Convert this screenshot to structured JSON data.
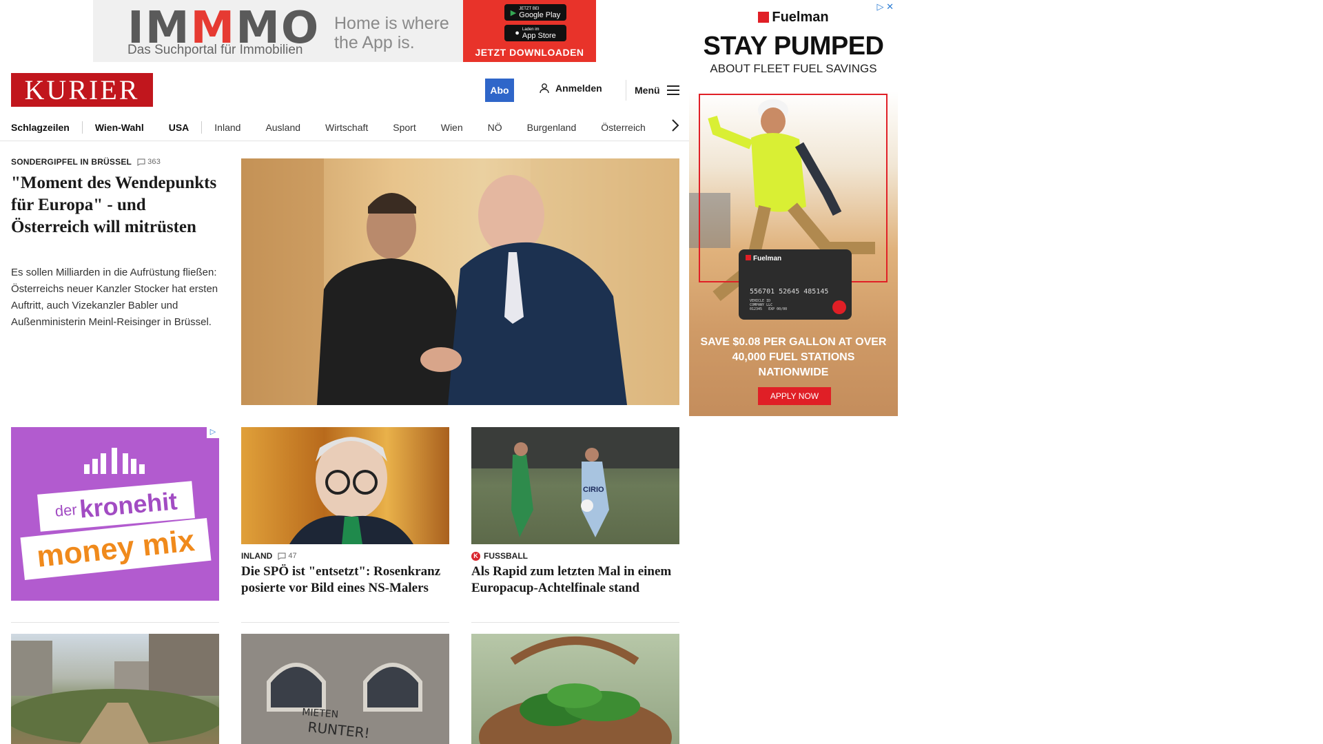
{
  "top_ad": {
    "logo_gray_1": "IM",
    "logo_red": "M",
    "logo_gray_2": "MO",
    "subline": "Das Suchportal für Immobilien",
    "tagline": "Home is where the App is.",
    "google_play_small": "JETZT BEI",
    "google_play": "Google Play",
    "app_store_small": "Laden im",
    "app_store": "App Store",
    "cta": "JETZT DOWNLOADEN"
  },
  "header": {
    "logo": "KURIER",
    "abo": "Abo",
    "login": "Anmelden",
    "menu": "Menü"
  },
  "nav": {
    "items": [
      "Schlagzeilen",
      "Wien-Wahl",
      "USA",
      "Inland",
      "Ausland",
      "Wirtschaft",
      "Sport",
      "Wien",
      "NÖ",
      "Burgenland",
      "Österreich"
    ]
  },
  "main_article": {
    "kicker": "SONDERGIPFEL IN BRÜSSEL",
    "comments": "363",
    "title": "\"Moment des Wendepunkts für Europa\" - und Österreich will mitrüsten",
    "teaser": "Es sollen Milliarden in die Aufrüstung fließen: Österreichs neuer Kanzler Stocker hat ersten Auftritt, auch Vizekanzler Babler und Außenministerin Meinl-Reisinger in Brüssel."
  },
  "side_ad": {
    "brand": "Fuelman",
    "headline": "STAY PUMPED",
    "subline": "ABOUT FLEET FUEL SAVINGS",
    "card_brand": "Fuelman",
    "card_number": "556701 52645 485145",
    "card_line1": "VEHICLE ID",
    "card_line2": "COMPANY LLC",
    "card_line3": "012345",
    "card_exp": "EXP 00/00",
    "promo": "SAVE $0.08 PER GALLON AT OVER 40,000 FUEL STATIONS NATIONWIDE",
    "cta": "APPLY NOW"
  },
  "krone_ad": {
    "line1_small": "der",
    "line1": "kronehit",
    "line2": "money mix"
  },
  "tiles": [
    {
      "kicker": "INLAND",
      "comments": "47",
      "title": "Die SPÖ ist \"entsetzt\": Rosenkranz posierte vor Bild eines NS-Malers"
    },
    {
      "kicker": "FUSSBALL",
      "title": "Als Rapid zum letzten Mal in einem Europacup-Achtelfinale stand",
      "badge_color": "#d9262e"
    }
  ],
  "photo_texts": {
    "jersey": "CIRIO",
    "graffiti_1": "MIETEN",
    "graffiti_2": "RUNTER!"
  },
  "colors": {
    "kurier_red": "#c1161d",
    "abo_blue": "#2f66c9",
    "immo_red": "#e63a32",
    "fuelman_red": "#e01f26",
    "krone_purple": "#b25bcf"
  }
}
